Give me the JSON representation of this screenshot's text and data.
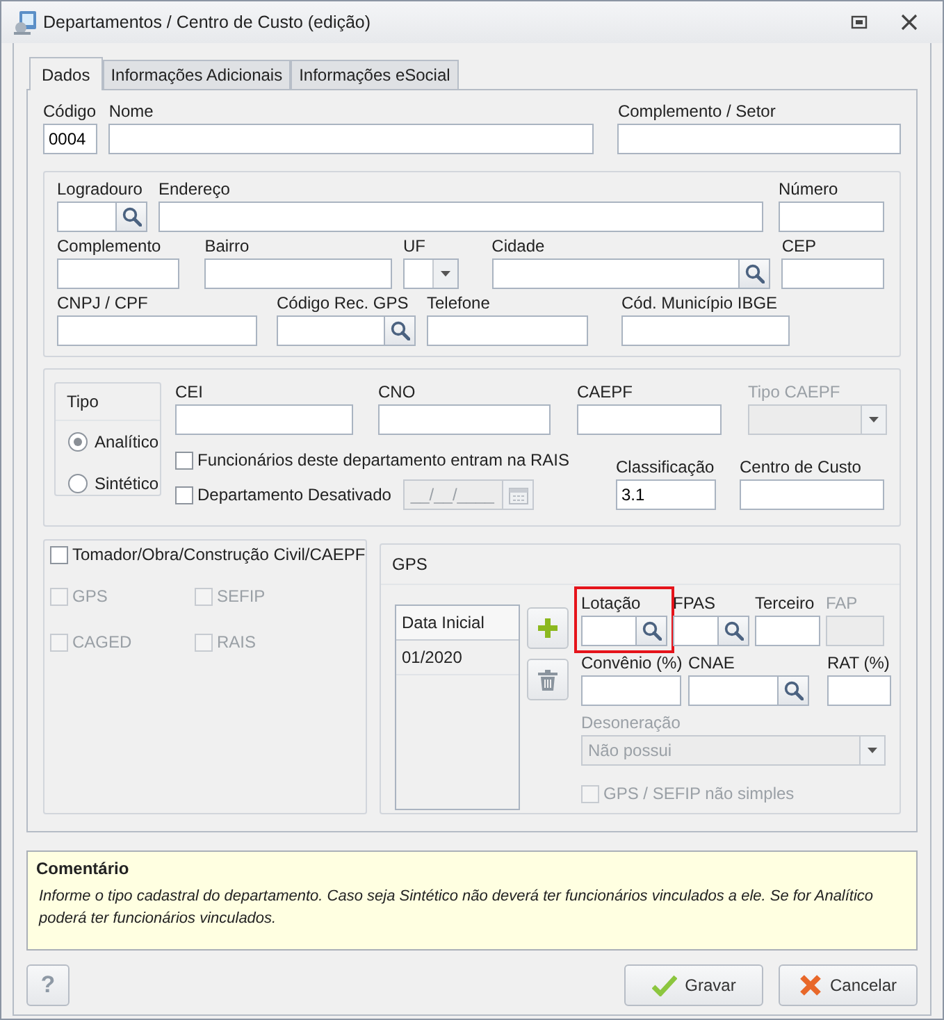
{
  "window": {
    "title": "Departamentos / Centro de Custo (edição)"
  },
  "tabs": [
    {
      "label": "Dados",
      "selected": true
    },
    {
      "label": "Informações Adicionais",
      "selected": false
    },
    {
      "label": "Informações eSocial",
      "selected": false
    }
  ],
  "header_fields": [
    {
      "label": "Código",
      "kind": "text",
      "value": "0004"
    },
    {
      "label": "Nome",
      "kind": "text"
    },
    {
      "label": "Complemento / Setor",
      "kind": "text"
    }
  ],
  "address_rows": [
    [
      {
        "label": "Logradouro",
        "kind": "lookup"
      },
      {
        "label": "Endereço",
        "kind": "text"
      },
      {
        "label": "Número",
        "kind": "text"
      }
    ],
    [
      {
        "label": "Complemento",
        "kind": "text"
      },
      {
        "label": "Bairro",
        "kind": "text"
      },
      {
        "label": "UF",
        "kind": "select"
      },
      {
        "label": "Cidade",
        "kind": "lookup"
      },
      {
        "label": "CEP",
        "kind": "text"
      }
    ],
    [
      {
        "label": "CNPJ / CPF",
        "kind": "text"
      },
      {
        "label": "Código Rec. GPS",
        "kind": "lookup"
      },
      {
        "label": "Telefone",
        "kind": "text"
      },
      {
        "label": "Cód. Município IBGE",
        "kind": "text"
      }
    ]
  ],
  "tipo": {
    "title": "Tipo",
    "options": [
      {
        "label": "Analítico",
        "selected": true
      },
      {
        "label": "Sintético",
        "selected": false
      }
    ]
  },
  "id_fields": [
    {
      "label": "CEI",
      "kind": "text"
    },
    {
      "label": "CNO",
      "kind": "text"
    },
    {
      "label": "CAEPF",
      "kind": "text"
    },
    {
      "label": "Tipo CAEPF",
      "kind": "select",
      "disabled": true
    }
  ],
  "checks": [
    {
      "label": "Funcionários deste departamento entram na RAIS",
      "checked": false
    },
    {
      "label": "Departamento Desativado",
      "checked": false,
      "date_mask": "__/__/____"
    }
  ],
  "class_fields": [
    {
      "label": "Classificação",
      "kind": "text",
      "value": "3.1"
    },
    {
      "label": "Centro de Custo",
      "kind": "text"
    }
  ],
  "tomador": {
    "label": "Tomador/Obra/Construção Civil/CAEPF",
    "checked": false,
    "options": [
      {
        "label": "GPS",
        "checked": false,
        "disabled": true
      },
      {
        "label": "SEFIP",
        "checked": false,
        "disabled": true
      },
      {
        "label": "CAGED",
        "checked": false,
        "disabled": true
      },
      {
        "label": "RAIS",
        "checked": false,
        "disabled": true
      }
    ]
  },
  "gps": {
    "title": "GPS",
    "table": {
      "column": "Data Inicial",
      "rows": [
        "01/2020"
      ]
    },
    "field_rows": [
      [
        {
          "label": "Lotação",
          "kind": "lookup",
          "highlighted": true
        },
        {
          "label": "FPAS",
          "kind": "lookup"
        },
        {
          "label": "Terceiro",
          "kind": "text"
        },
        {
          "label": "FAP",
          "kind": "text",
          "disabled": true
        }
      ],
      [
        {
          "label": "Convênio (%)",
          "kind": "text"
        },
        {
          "label": "CNAE",
          "kind": "lookup"
        },
        {
          "label": "RAT (%)",
          "kind": "text"
        }
      ]
    ],
    "desoneracao": {
      "label": "Desoneração",
      "value": "Não possui",
      "disabled": true
    },
    "simples": {
      "label": "GPS / SEFIP não simples",
      "checked": false,
      "disabled": true
    }
  },
  "comment": {
    "title": "Comentário",
    "text": "Informe o tipo cadastral do departamento. Caso seja Sintético não deverá ter funcionários vinculados a ele. Se for Analítico poderá ter funcionários vinculados."
  },
  "help_button": {
    "label": "?"
  },
  "buttons": [
    {
      "label": "Gravar",
      "kind": "save"
    },
    {
      "label": "Cancelar",
      "kind": "cancel"
    }
  ]
}
